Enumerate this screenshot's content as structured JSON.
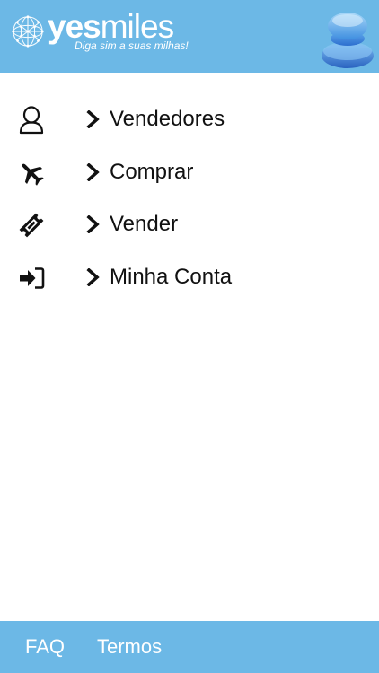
{
  "header": {
    "logo": {
      "word_bold": "yes",
      "word_light": "miles",
      "tagline": "Diga sim a suas milhas!"
    },
    "menu_toggle_icon": "blue-layered-disc-icon",
    "background_color": "#6cb8e6"
  },
  "menu": {
    "items": [
      {
        "label": "Vendedores",
        "icon": "user-outline-icon"
      },
      {
        "label": "Comprar",
        "icon": "airplane-icon"
      },
      {
        "label": "Vender",
        "icon": "ticket-icon"
      },
      {
        "label": "Minha Conta",
        "icon": "sign-in-icon"
      }
    ],
    "chevron_icon": "chevron-right-icon"
  },
  "footer": {
    "faq_label": "FAQ",
    "terms_label": "Termos",
    "background_color": "#6cb8e6"
  }
}
